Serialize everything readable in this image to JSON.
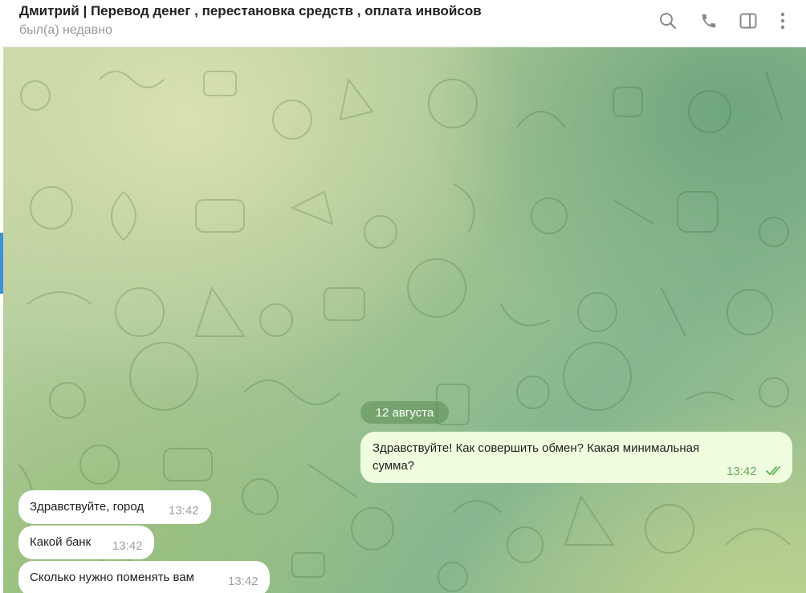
{
  "header": {
    "title": "Дмитрий | Перевод денег , перестановка средств , оплата инвойсов",
    "status": "был(а) недавно",
    "icons": [
      "search-icon",
      "phone-icon",
      "sidebar-toggle-icon",
      "more-vertical-icon"
    ]
  },
  "chat": {
    "date_label": "12 августа",
    "messages": [
      {
        "direction": "out",
        "lines": [
          "Здравствуйте! Как совершить обмен? Какая минимальная",
          "сумма?"
        ],
        "time": "13:42",
        "read": true
      },
      {
        "direction": "in",
        "lines": [
          "Здравствуйте, город"
        ],
        "time": "13:42"
      },
      {
        "direction": "in",
        "lines": [
          "Какой банк"
        ],
        "time": "13:42"
      },
      {
        "direction": "in",
        "lines": [
          "Сколько нужно поменять вам"
        ],
        "time": "13:42"
      }
    ]
  },
  "colors": {
    "outgoing_bubble": "#effdde",
    "incoming_bubble": "#ffffff",
    "read_check": "#5fb25a",
    "date_pill": "#6f9e5f"
  }
}
